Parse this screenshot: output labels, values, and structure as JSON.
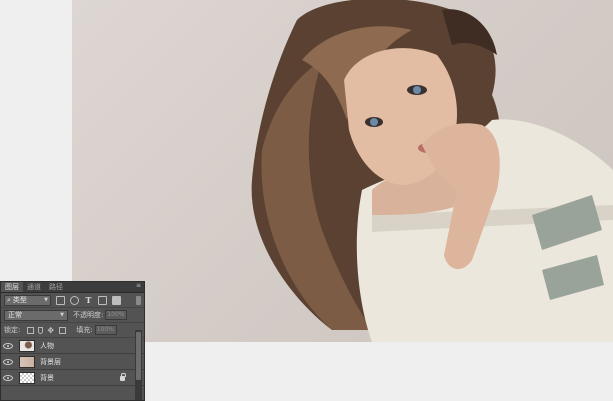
{
  "panel": {
    "tabs": [
      "图层",
      "通道",
      "路径"
    ],
    "filter": {
      "label": "类型"
    },
    "blend_mode": "正常",
    "opacity_label": "不透明度:",
    "opacity_value": "100%",
    "lock_label": "锁定:",
    "fill_label": "填充:",
    "fill_value": "100%",
    "layers": [
      {
        "name": "人物",
        "visible": true,
        "thumb": "person"
      },
      {
        "name": "背景层",
        "visible": true,
        "thumb": "color"
      },
      {
        "name": "背景",
        "visible": true,
        "thumb": "transparent",
        "locked": true
      }
    ]
  },
  "colors": {
    "panel_bg": "#535353",
    "tab_bar": "#3c3c3c",
    "canvas_bg": "#efefef",
    "photo_bg": "#d6cfcb"
  }
}
